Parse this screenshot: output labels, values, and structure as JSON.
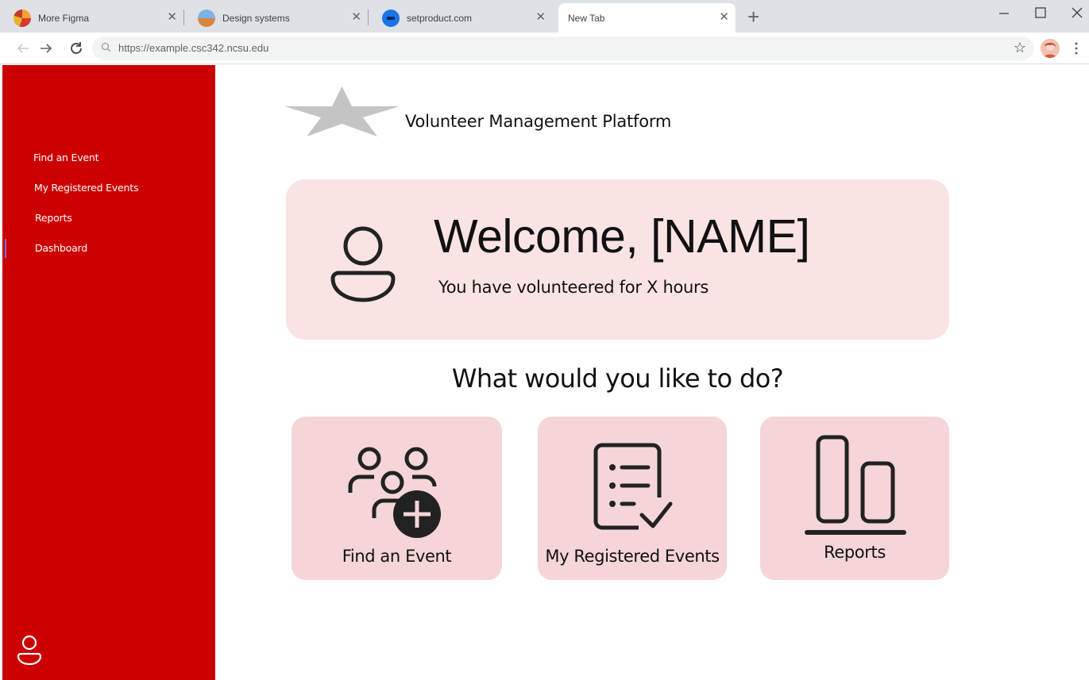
{
  "browser": {
    "tabs": [
      {
        "title": "More Figma",
        "icon": "figma-favicon-icon"
      },
      {
        "title": "Design systems",
        "icon": "design-systems-favicon-icon"
      },
      {
        "title": "setproduct.com",
        "icon": "setproduct-favicon-icon"
      },
      {
        "title": "New Tab",
        "icon": ""
      }
    ],
    "close_glyph": "✕",
    "new_tab_glyph": "+",
    "url": "https://example.csc342.ncsu.edu",
    "star_glyph": "☆"
  },
  "sidebar": {
    "items": [
      {
        "label": "Find an Event"
      },
      {
        "label": "My Registered Events"
      },
      {
        "label": "Reports"
      },
      {
        "label": "Dashboard"
      }
    ],
    "accent_color": "#cc0000",
    "active_item": "Dashboard"
  },
  "header": {
    "title": "Volunteer Management Platform"
  },
  "welcome": {
    "title": "Welcome, [NAME]",
    "subtitle": "You have volunteered for X hours"
  },
  "actions": {
    "prompt": "What would you like to do?",
    "cards": [
      {
        "label": "Find an Event",
        "icon": "group-add-icon"
      },
      {
        "label": "My Registered Events",
        "icon": "checklist-icon"
      },
      {
        "label": "Reports",
        "icon": "bar-align-icon"
      }
    ]
  },
  "colors": {
    "welcome_card": "#fae3e3",
    "action_card": "#f5d5d7"
  }
}
